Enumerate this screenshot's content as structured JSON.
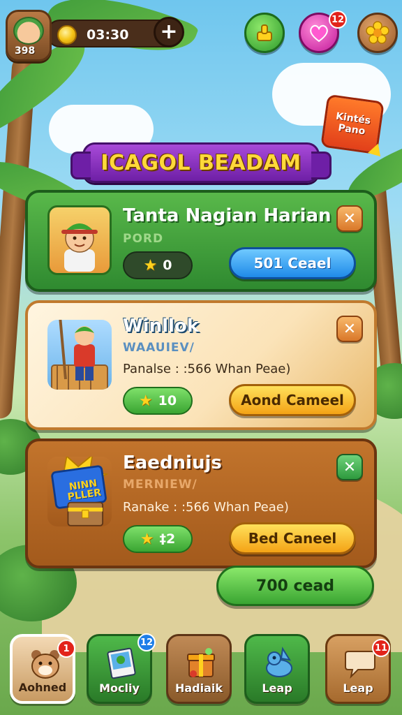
{
  "player": {
    "level": "398",
    "coins": "03:30"
  },
  "top_icons": {
    "messages_badge": "12"
  },
  "promo": {
    "label": "Kintés Pano"
  },
  "banner": {
    "title": "ICAGOL BEADAM"
  },
  "cards": [
    {
      "title": "Tanta Nagian Harian",
      "subtitle": "PORD",
      "description": "",
      "stars": "0",
      "action": "501 Ceael",
      "close": "✕"
    },
    {
      "title": "Winllok",
      "subtitle": "WAAUIEV/",
      "description": "Panalse : :566 Whan Peae)",
      "stars": "10",
      "action": "Aond Cameel",
      "close": "✕"
    },
    {
      "title": "Eaedniujs",
      "subtitle": "MERNIEW/",
      "description": "Ranake : :566 Whan Peae)",
      "stars": "‡2",
      "action": "Bed Caneel",
      "close": "✕",
      "thumb_text": "NINN PLLER"
    }
  ],
  "big_button": {
    "label": "700 cead"
  },
  "nav": [
    {
      "label": "Aohned",
      "badge": "1",
      "icon": "hamster-icon",
      "active": true
    },
    {
      "label": "Mocliy",
      "badge": "12",
      "icon": "photo-card-icon"
    },
    {
      "label": "Hadiaik",
      "badge": "",
      "icon": "gift-box-icon"
    },
    {
      "label": "Leap",
      "badge": "",
      "icon": "blue-creature-icon"
    },
    {
      "label": "Leap",
      "badge": "11",
      "icon": "speech-bubble-icon"
    }
  ],
  "colors": {
    "title_banner": "#6e1fa6",
    "title_text": "#ffd93a",
    "card_green": "#2f8a30",
    "card_cream": "#fbe3b8",
    "card_brown": "#a35a1c",
    "button_blue": "#1f8ae8",
    "button_yellow": "#f4a316",
    "button_green": "#3aa532",
    "notification_red": "#e2231a"
  }
}
